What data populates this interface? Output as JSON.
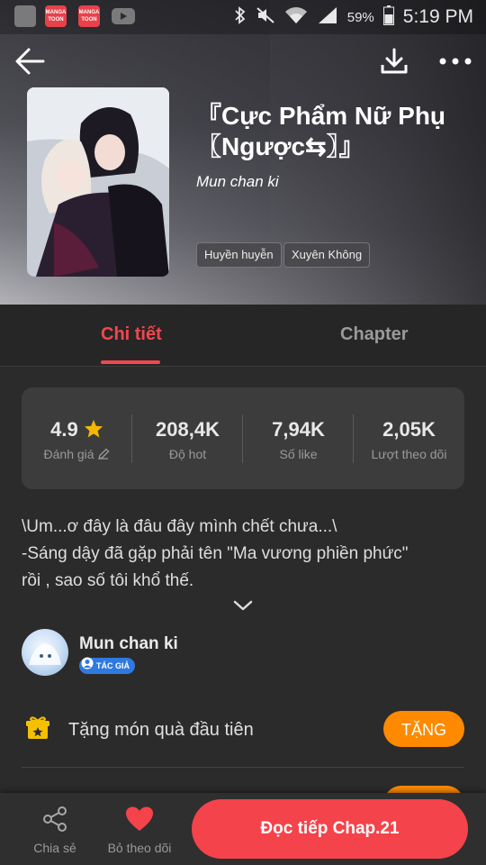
{
  "status_bar": {
    "app_badges": [
      "MANGA TOON",
      "MANGA TOON"
    ],
    "battery": "59%",
    "time": "5:19 PM"
  },
  "header": {
    "title": "『Cực Phẩm Nữ Phụ〖Ngược⇆〗』",
    "author": "Mun chan ki",
    "tags": [
      "Huyền huyễn",
      "Xuyên Không"
    ]
  },
  "tabs": [
    {
      "label": "Chi tiết",
      "active": true
    },
    {
      "label": "Chapter",
      "active": false
    }
  ],
  "stats": [
    {
      "value": "4.9",
      "label": "Đánh giá"
    },
    {
      "value": "208,4K",
      "label": "Độ hot"
    },
    {
      "value": "7,94K",
      "label": "Số like"
    },
    {
      "value": "2,05K",
      "label": "Lượt theo dõi"
    }
  ],
  "description": {
    "line1": "\\Um...ơ đây là đâu đây mình chết chưa...\\",
    "line2": "-Sáng dậy đã gặp phải tên \"Ma vương phiền phức\"",
    "line3": "rồi , sao số tôi khổ thế."
  },
  "author_row": {
    "name": "Mun chan ki",
    "badge": "TÁC GIẢ"
  },
  "gift": {
    "text": "Tặng món quà đầu tiên",
    "button": "TẶNG"
  },
  "bottom_bar": {
    "share_label": "Chia sẻ",
    "unfollow_label": "Bỏ theo dõi",
    "read_button": "Đọc tiếp Chap.21"
  },
  "colors": {
    "accent": "#f2474f",
    "orange": "#ff8a00",
    "background": "#2b2b2b",
    "card": "#3c3c3c",
    "star": "#f5b800"
  },
  "icons": [
    "back-arrow-icon",
    "download-icon",
    "more-icon",
    "star-icon",
    "pencil-icon",
    "chevron-down-icon",
    "gift-icon",
    "share-icon",
    "heart-icon",
    "wifi-icon",
    "bluetooth-icon",
    "signal-icon",
    "battery-icon",
    "mute-icon"
  ]
}
